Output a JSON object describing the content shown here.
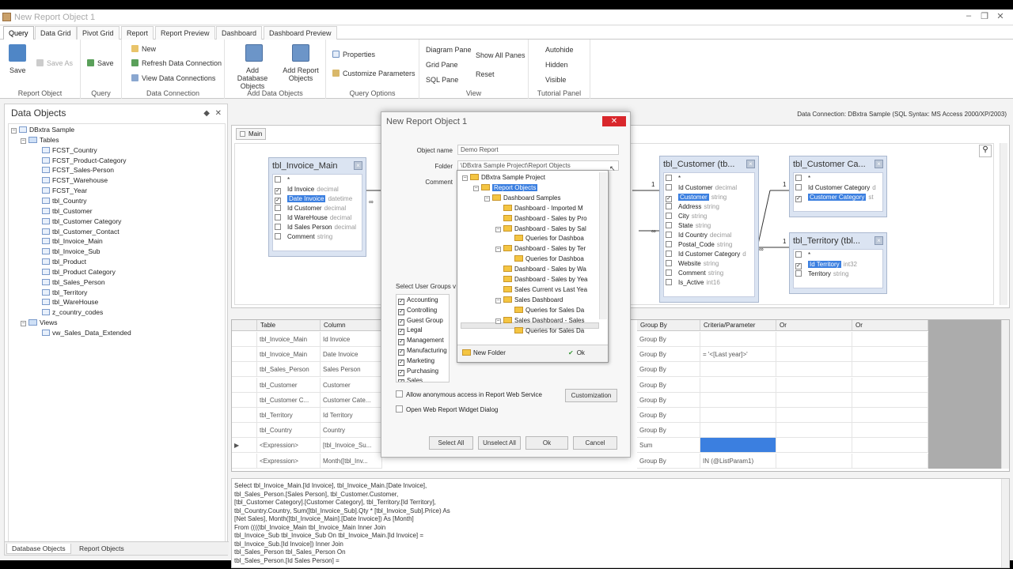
{
  "window": {
    "title": "New Report Object 1"
  },
  "tabs": [
    "Query",
    "Data Grid",
    "Pivot Grid",
    "Report",
    "Report Preview",
    "Dashboard",
    "Dashboard Preview"
  ],
  "ribbon": {
    "report_object": {
      "save": "Save",
      "save_as": "Save As",
      "label": "Report Object"
    },
    "query": {
      "save": "Save",
      "label": "Query"
    },
    "data_connection": {
      "new": "New",
      "refresh": "Refresh Data Connection",
      "view": "View Data Connections",
      "label": "Data Connection"
    },
    "add_objects": {
      "add_db": "Add Database Objects",
      "add_report": "Add Report Objects",
      "label": "Add Data Objects"
    },
    "query_options": {
      "properties": "Properties",
      "customize": "Customize Parameters",
      "label": "Query Options"
    },
    "view": {
      "diagram": "Diagram Pane",
      "grid": "Grid Pane",
      "sql": "SQL Pane",
      "show_all": "Show All Panes",
      "reset": "Reset",
      "label": "View"
    },
    "tutorial": {
      "autohide": "Autohide",
      "hidden": "Hidden",
      "visible": "Visible",
      "label": "Tutorial Panel"
    }
  },
  "left_panel": {
    "title": "Data Objects",
    "root": "DBxtra Sample",
    "tables_label": "Tables",
    "tables": [
      "FCST_Country",
      "FCST_Product-Category",
      "FCST_Sales-Person",
      "FCST_Warehouse",
      "FCST_Year",
      "tbl_Country",
      "tbl_Customer",
      "tbl_Customer Category",
      "tbl_Customer_Contact",
      "tbl_Invoice_Main",
      "tbl_Invoice_Sub",
      "tbl_Product",
      "tbl_Product Category",
      "tbl_Sales_Person",
      "tbl_Territory",
      "tbl_WareHouse",
      "z_country_codes"
    ],
    "views_label": "Views",
    "views": [
      "vw_Sales_Data_Extended"
    ],
    "tab_db": "Database Objects",
    "tab_report": "Report Objects"
  },
  "connection": "Data Connection: DBxtra Sample (SQL Syntax: MS Access 2000/XP/2003)",
  "designer": {
    "tab": "Main",
    "tables": [
      {
        "name": "tbl_Invoice_Main",
        "fields": [
          {
            "n": "*",
            "t": "",
            "c": false
          },
          {
            "n": "Id Invoice",
            "t": "decimal",
            "c": true
          },
          {
            "n": "Date Invoice",
            "t": "datetime",
            "c": true,
            "sel": true
          },
          {
            "n": "Id Customer",
            "t": "decimal",
            "c": false
          },
          {
            "n": "Id WareHouse",
            "t": "decimal",
            "c": false
          },
          {
            "n": "Id Sales Person",
            "t": "decimal",
            "c": false
          },
          {
            "n": "Comment",
            "t": "string",
            "c": false
          }
        ]
      },
      {
        "name": "tbl_Customer (tb...",
        "fields": [
          {
            "n": "*",
            "t": "",
            "c": false
          },
          {
            "n": "Id Customer",
            "t": "decimal",
            "c": false
          },
          {
            "n": "Customer",
            "t": "string",
            "c": true,
            "sel": true
          },
          {
            "n": "Address",
            "t": "string",
            "c": false
          },
          {
            "n": "City",
            "t": "string",
            "c": false
          },
          {
            "n": "State",
            "t": "string",
            "c": false
          },
          {
            "n": "Id Country",
            "t": "decimal",
            "c": false
          },
          {
            "n": "Postal_Code",
            "t": "string",
            "c": false
          },
          {
            "n": "Id Customer Category",
            "t": "d",
            "c": false
          },
          {
            "n": "Website",
            "t": "string",
            "c": false
          },
          {
            "n": "Comment",
            "t": "string",
            "c": false
          },
          {
            "n": "Is_Active",
            "t": "int16",
            "c": false
          }
        ]
      },
      {
        "name": "tbl_Customer Ca...",
        "fields": [
          {
            "n": "*",
            "t": "",
            "c": false
          },
          {
            "n": "Id Customer Category",
            "t": "d",
            "c": false
          },
          {
            "n": "Customer Category",
            "t": "st",
            "c": true,
            "sel": true
          }
        ]
      },
      {
        "name": "tbl_Territory (tbl...",
        "fields": [
          {
            "n": "*",
            "t": "",
            "c": false
          },
          {
            "n": "Id Territory",
            "t": "int32",
            "c": true,
            "sel": true
          },
          {
            "n": "Territory",
            "t": "string",
            "c": false
          }
        ]
      }
    ]
  },
  "grid": {
    "headers": [
      "Table",
      "Column",
      "Group By",
      "Criteria/Parameter",
      "Or",
      "Or"
    ],
    "rows": [
      [
        "tbl_Invoice_Main",
        "Id Invoice",
        "Group By",
        ""
      ],
      [
        "tbl_Invoice_Main",
        "Date Invoice",
        "Group By",
        "= '<[Last year]>'"
      ],
      [
        "tbl_Sales_Person",
        "Sales Person",
        "Group By",
        ""
      ],
      [
        "tbl_Customer",
        "Customer",
        "Group By",
        ""
      ],
      [
        "tbl_Customer C...",
        "Customer Cate...",
        "Group By",
        ""
      ],
      [
        "tbl_Territory",
        "Id Territory",
        "Group By",
        ""
      ],
      [
        "tbl_Country",
        "Country",
        "Group By",
        ""
      ],
      [
        "<Expression>",
        "[tbl_Invoice_Su...",
        "Sum",
        ""
      ],
      [
        "<Expression>",
        "Month([tbl_Inv...",
        "Group By",
        "IN (@ListParam1)"
      ]
    ]
  },
  "sql": [
    "Select tbl_Invoice_Main.[Id Invoice], tbl_Invoice_Main.[Date Invoice],",
    "  tbl_Sales_Person.[Sales Person], tbl_Customer.Customer,",
    "  [tbl_Customer Category].[Customer Category], tbl_Territory.[Id Territory],",
    "  tbl_Country.Country, Sum([tbl_Invoice_Sub].Qty * [tbl_Invoice_Sub].Price) As",
    "  [Net Sales], Month([tbl_Invoice_Main].[Date Invoice]) As [Month]",
    "From ((((tbl_Invoice_Main tbl_Invoice_Main Inner Join",
    "      tbl_Invoice_Sub tbl_Invoice_Sub On tbl_Invoice_Main.[Id Invoice] =",
    "      tbl_Invoice_Sub.[Id Invoice]) Inner Join",
    "    tbl_Sales_Person tbl_Sales_Person On",
    "    tbl_Sales_Person.[Id Sales Person] ="
  ],
  "dialog": {
    "title": "New Report Object 1",
    "object_name_label": "Object name",
    "object_name": "Demo Report",
    "folder_label": "Folder",
    "folder": "\\DBxtra Sample Project\\Report Objects",
    "comment_label": "Comment",
    "user_groups_label": "Select User Groups v",
    "user_groups": [
      "Accounting",
      "Controlling",
      "Guest Group",
      "Legal",
      "Management",
      "Manufacturing",
      "Marketing",
      "Purchasing",
      "Sales"
    ],
    "anon_label": "Allow anonymous access in Report Web Service",
    "customization": "Customization",
    "widget_label": "Open Web Report Widget Dialog",
    "select_all": "Select All",
    "unselect_all": "Unselect All",
    "ok": "Ok",
    "cancel": "Cancel"
  },
  "folder_tree": {
    "nodes": [
      {
        "label": "DBxtra Sample Project",
        "lvl": 0,
        "exp": "-"
      },
      {
        "label": "Report Objects",
        "lvl": 1,
        "exp": "-",
        "sel": true
      },
      {
        "label": "Dashboard Samples",
        "lvl": 2,
        "exp": "-"
      },
      {
        "label": "Dashboard - Imported M",
        "lvl": 3,
        "exp": ""
      },
      {
        "label": "Dashboard - Sales by Pro",
        "lvl": 3,
        "exp": ""
      },
      {
        "label": "Dashboard - Sales by Sal",
        "lvl": 3,
        "exp": "-"
      },
      {
        "label": "Queries for Dashboa",
        "lvl": 4,
        "exp": ""
      },
      {
        "label": "Dashboard - Sales by Ter",
        "lvl": 3,
        "exp": "-"
      },
      {
        "label": "Queries for Dashboa",
        "lvl": 4,
        "exp": ""
      },
      {
        "label": "Dashboard - Sales by Wa",
        "lvl": 3,
        "exp": ""
      },
      {
        "label": "Dashboard - Sales by Yea",
        "lvl": 3,
        "exp": ""
      },
      {
        "label": "Sales Current vs Last Yea",
        "lvl": 3,
        "exp": ""
      },
      {
        "label": "Sales Dashboard",
        "lvl": 3,
        "exp": "-"
      },
      {
        "label": "Queries for Sales Da",
        "lvl": 4,
        "exp": ""
      },
      {
        "label": "Sales Dashboard - Sales",
        "lvl": 3,
        "exp": "-"
      },
      {
        "label": "Queries for Sales Da",
        "lvl": 4,
        "exp": ""
      }
    ],
    "new_folder": "New Folder",
    "ok": "Ok"
  },
  "colors": {
    "accent": "#3b7fe0",
    "close": "#d9272c",
    "table_box": "#dbe4f2"
  }
}
